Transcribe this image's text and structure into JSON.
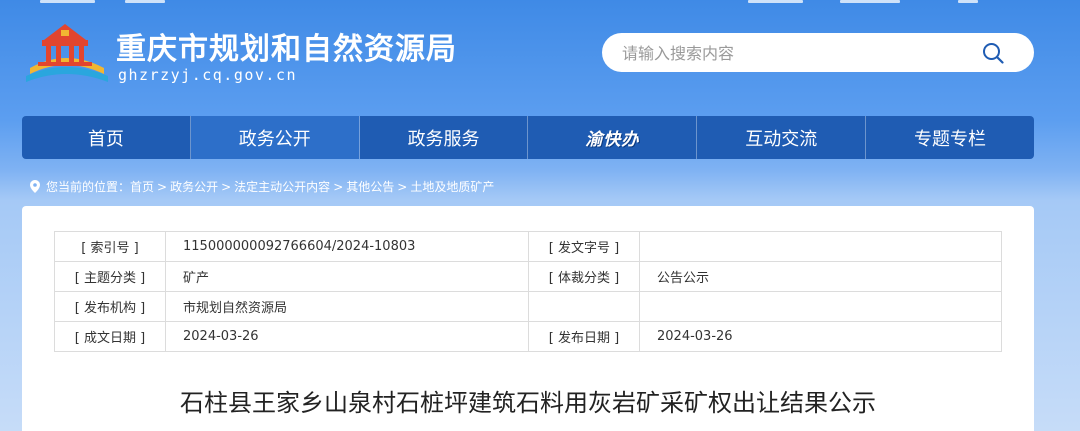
{
  "header": {
    "site_title": "重庆市规划和自然资源局",
    "site_domain": "ghzrzyj.cq.gov.cn",
    "logo_icon": "government-building-logo-icon"
  },
  "search": {
    "placeholder": "请输入搜索内容",
    "icon": "search-icon"
  },
  "nav": {
    "items": [
      {
        "label": "首页"
      },
      {
        "label": "政务公开"
      },
      {
        "label": "政务服务"
      },
      {
        "label": "渝快办"
      },
      {
        "label": "互动交流"
      },
      {
        "label": "专题专栏"
      }
    ]
  },
  "breadcrumb": {
    "prefix": "您当前的位置：",
    "items": [
      "首页",
      "政务公开",
      "法定主动公开内容",
      "其他公告",
      "土地及地质矿产"
    ],
    "separator": ">"
  },
  "meta": {
    "index_label": "[ 索引号 ]",
    "index_value": "115000000092766604/2024-10803",
    "doc_no_label": "[ 发文字号 ]",
    "doc_no_value": "",
    "topic_label": "[ 主题分类 ]",
    "topic_value": "矿产",
    "genre_label": "[ 体裁分类 ]",
    "genre_value": "公告公示",
    "publisher_label": "[ 发布机构 ]",
    "publisher_value": "市规划自然资源局",
    "created_label": "[ 成文日期 ]",
    "created_value": "2024-03-26",
    "published_label": "[ 发布日期 ]",
    "published_value": "2024-03-26"
  },
  "article": {
    "title": "石柱县王家乡山泉村石桩坪建筑石料用灰岩矿采矿权出让结果公示"
  },
  "colors": {
    "nav_bg": "#1f5cb3",
    "nav_active": "#2d6fc9",
    "header_bg": "#3f8ae6"
  }
}
